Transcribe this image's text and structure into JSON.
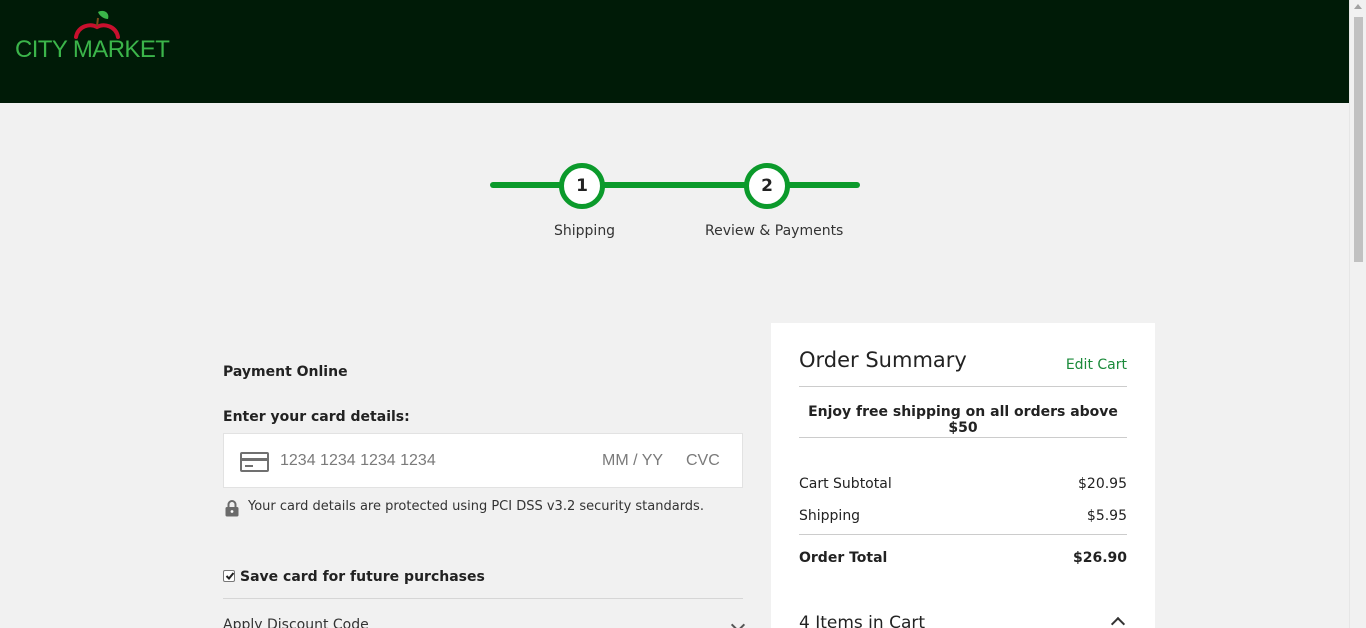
{
  "header": {
    "logo_text": "CITY MARKET",
    "logo_colors": {
      "text": "#3bb54a",
      "apple": "#c8102e",
      "leaf": "#3bb54a"
    },
    "background": "#001b07"
  },
  "stepper": {
    "steps": [
      {
        "number": "1",
        "label": "Shipping"
      },
      {
        "number": "2",
        "label": "Review & Payments"
      }
    ],
    "accent": "#0b9a2b"
  },
  "payment": {
    "title": "Payment Online",
    "card_label": "Enter your card details:",
    "card_icon": "credit-card-icon",
    "card_number_placeholder": "1234 1234 1234 1234",
    "expiry_placeholder": "MM / YY",
    "cvc_placeholder": "CVC",
    "secure_icon": "lock-icon",
    "secure_text": "Your card details are protected using PCI DSS v3.2 security standards.",
    "save_card_label": "Save card for future purchases",
    "save_card_checked": true,
    "discount_label": "Apply Discount Code"
  },
  "summary": {
    "title": "Order Summary",
    "edit_cart": "Edit Cart",
    "free_shipping": "Enjoy free shipping on all orders above $50",
    "subtotal_label": "Cart Subtotal",
    "subtotal_value": "$20.95",
    "shipping_label": "Shipping",
    "shipping_value": "$5.95",
    "total_label": "Order Total",
    "total_value": "$26.90",
    "items_label": "4 Items in Cart",
    "link_color": "#1a8a3a"
  }
}
